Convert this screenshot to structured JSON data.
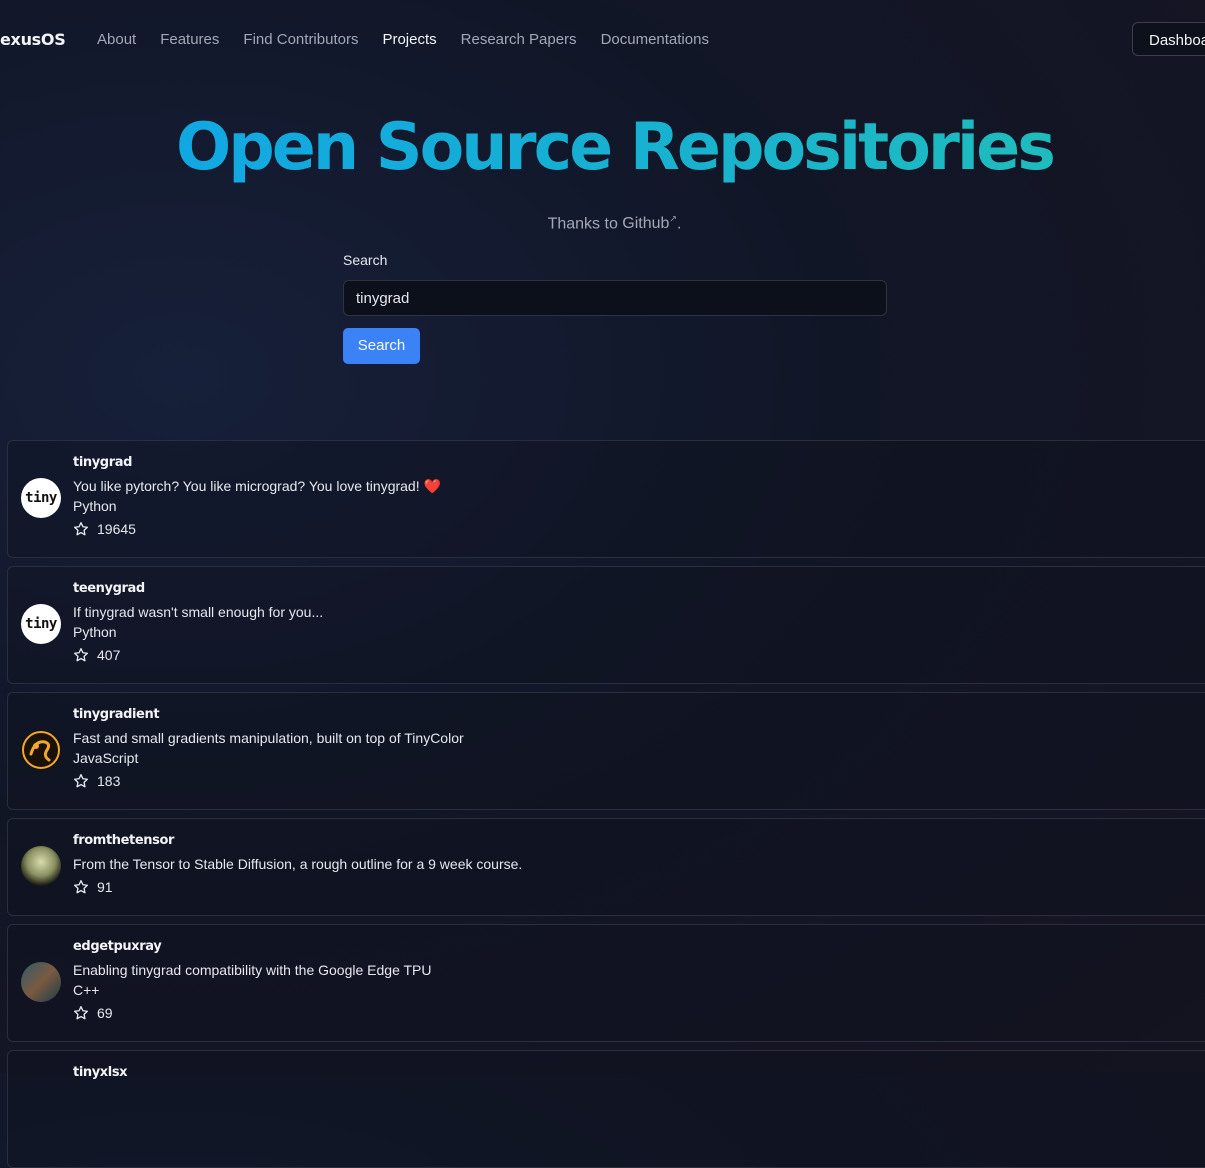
{
  "brand": "exusOS",
  "nav": {
    "links": [
      "About",
      "Features",
      "Find Contributors",
      "Projects",
      "Research Papers",
      "Documentations"
    ],
    "active": "Projects",
    "dashboard_label": "Dashboard"
  },
  "hero": {
    "title": "Open Source Repositories",
    "subtitle_prefix": "Thanks to ",
    "subtitle_link": "Github",
    "subtitle_suffix": "."
  },
  "search": {
    "label": "Search",
    "value": "tinygrad",
    "button_label": "Search"
  },
  "repos": [
    {
      "name": "tinygrad",
      "description": "You like pytorch? You like micrograd? You love tinygrad! ❤️",
      "language": "Python",
      "stars": "19645",
      "avatar": "tiny"
    },
    {
      "name": "teenygrad",
      "description": "If tinygrad wasn't small enough for you...",
      "language": "Python",
      "stars": "407",
      "avatar": "tiny"
    },
    {
      "name": "tinygradient",
      "description": "Fast and small gradients manipulation, built on top of TinyColor",
      "language": "JavaScript",
      "stars": "183",
      "avatar": "logo-icon"
    },
    {
      "name": "fromthetensor",
      "description": "From the Tensor to Stable Diffusion, a rough outline for a 9 week course.",
      "language": "",
      "stars": "91",
      "avatar": "portrait-icon"
    },
    {
      "name": "edgetpuxray",
      "description": "Enabling tinygrad compatibility with the Google Edge TPU",
      "language": "C++",
      "stars": "69",
      "avatar": "photo-icon"
    },
    {
      "name": "tinyxlsx",
      "description": "",
      "language": "",
      "stars": "",
      "avatar": ""
    }
  ],
  "colors": {
    "accent_button": "#3b82f6",
    "title_gradient_start": "#0ea5e9",
    "title_gradient_end": "#22c1b5",
    "background": "#111627"
  }
}
